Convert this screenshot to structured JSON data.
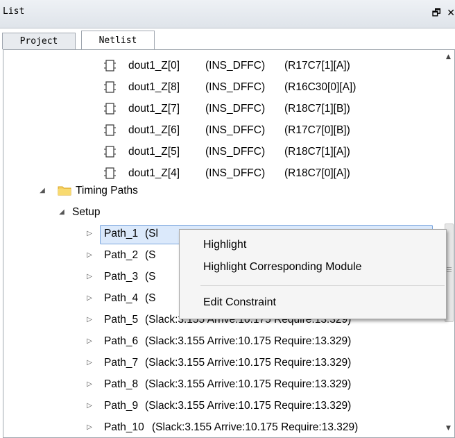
{
  "panel": {
    "title": "List",
    "restore_glyph": "🗗",
    "close_glyph": "✕"
  },
  "tabs": [
    {
      "label": "Project",
      "active": false
    },
    {
      "label": "Netlist",
      "active": true
    }
  ],
  "registers": [
    {
      "name": "dout1_Z[0]",
      "type": "(INS_DFFC)",
      "loc": "(R17C7[1][A])"
    },
    {
      "name": "dout1_Z[8]",
      "type": "(INS_DFFC)",
      "loc": "(R16C30[0][A])"
    },
    {
      "name": "dout1_Z[7]",
      "type": "(INS_DFFC)",
      "loc": "(R18C7[1][B])"
    },
    {
      "name": "dout1_Z[6]",
      "type": "(INS_DFFC)",
      "loc": "(R17C7[0][B])"
    },
    {
      "name": "dout1_Z[5]",
      "type": "(INS_DFFC)",
      "loc": "(R18C7[1][A])"
    },
    {
      "name": "dout1_Z[4]",
      "type": "(INS_DFFC)",
      "loc": "(R18C7[0][A])"
    }
  ],
  "timing_group": {
    "label": "Timing Paths",
    "icon": "folder-icon"
  },
  "setup_group": {
    "label": "Setup"
  },
  "paths": [
    {
      "name": "Path_1",
      "detail": "(Sl"
    },
    {
      "name": "Path_2",
      "detail": "(S"
    },
    {
      "name": "Path_3",
      "detail": "(S"
    },
    {
      "name": "Path_4",
      "detail": "(S"
    },
    {
      "name": "Path_5",
      "detail": "(Slack:3.155 Arrive:10.175 Require:13.329)"
    },
    {
      "name": "Path_6",
      "detail": "(Slack:3.155 Arrive:10.175 Require:13.329)"
    },
    {
      "name": "Path_7",
      "detail": "(Slack:3.155 Arrive:10.175 Require:13.329)"
    },
    {
      "name": "Path_8",
      "detail": "(Slack:3.155 Arrive:10.175 Require:13.329)"
    },
    {
      "name": "Path_9",
      "detail": "(Slack:3.155 Arrive:10.175 Require:13.329)"
    },
    {
      "name": "Path_10",
      "detail": "(Slack:3.155 Arrive:10.175 Require:13.329)"
    }
  ],
  "context_menu": {
    "highlight": "Highlight",
    "highlight_module": "Highlight Corresponding Module",
    "edit_constraint": "Edit Constraint"
  },
  "colors": {
    "selection": "#dbe9fb",
    "folder": "#f0c040"
  }
}
